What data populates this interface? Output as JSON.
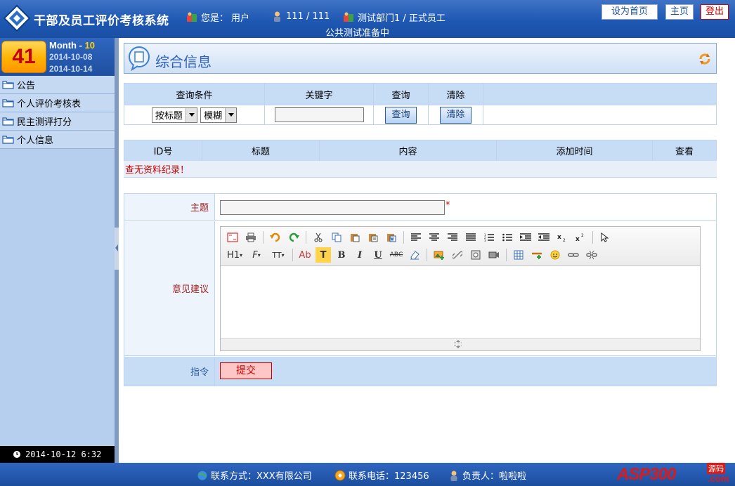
{
  "header": {
    "title": "干部及员工评价考核系统",
    "user_prefix": "您是：",
    "user": "用户",
    "id_text": "111 / 111",
    "dept_text": "测试部门1 / 正式员工",
    "notice": "公共测试准备中",
    "btn_set_home": "设为首页",
    "btn_home": "主页",
    "btn_logout": "登出"
  },
  "sidebar": {
    "day": "41",
    "month_label": "Month - ",
    "month_num": "10",
    "date_start": "2014-10-08",
    "date_end": "2014-10-14",
    "items": [
      {
        "label": "公告"
      },
      {
        "label": "个人评价考核表"
      },
      {
        "label": "民主测评打分"
      },
      {
        "label": "个人信息"
      }
    ],
    "clock": "2014-10-12 6:32"
  },
  "page": {
    "title": "综合信息"
  },
  "query": {
    "headers": [
      "查询条件",
      "关键字",
      "查询",
      "清除"
    ],
    "field_select": "按标题",
    "mode_select": "模糊",
    "keyword_value": "",
    "search_btn": "查询",
    "clear_btn": "清除"
  },
  "list": {
    "columns": [
      "ID号",
      "标题",
      "内容",
      "添加时间",
      "查看"
    ],
    "empty_message": "查无资料纪录！"
  },
  "form": {
    "subject_label": "主题",
    "subject_value": "",
    "required_mark": "*",
    "body_label": "意见建议",
    "cmd_label": "指令",
    "submit_btn": "提交",
    "toolbar_text": {
      "h1": "H1",
      "font": "F",
      "size": "TT",
      "color": "Ab",
      "bgcolor": "T",
      "bold": "B",
      "italic": "I",
      "underline": "U",
      "strike": "ABC"
    }
  },
  "footer": {
    "contact_label": "联系方式：XXX有限公司",
    "phone_label": "联系电话：123456",
    "owner_label": "负责人：啦啦啦",
    "brand": "ASP300",
    "brand_dot": ".com",
    "brand_tag": "源码"
  },
  "colors": {
    "header_blue": "#1e58b3",
    "sidebar_bg": "#b7cfee",
    "table_header": "#c7dcf5",
    "accent_red": "#c00000"
  }
}
